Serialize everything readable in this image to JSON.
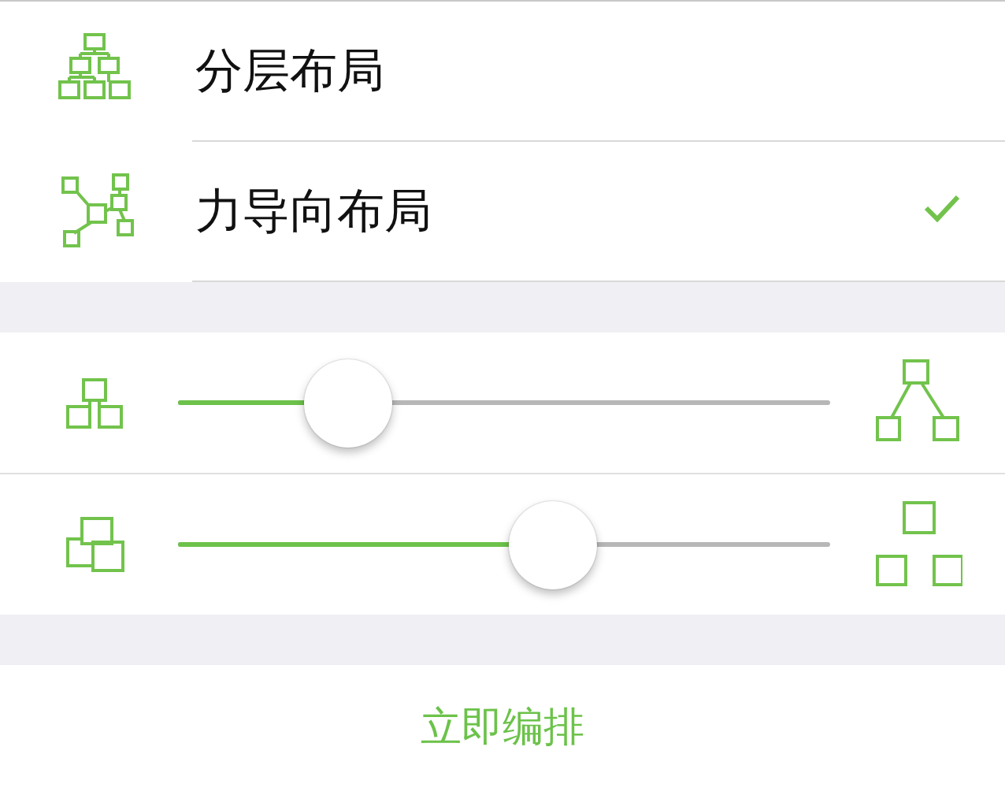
{
  "layouts": [
    {
      "label": "分层布局",
      "kind": "hierarchy",
      "selected": false
    },
    {
      "label": "力导向布局",
      "kind": "force",
      "selected": true
    }
  ],
  "sliders": [
    {
      "kind": "spacing",
      "level": 0.26
    },
    {
      "kind": "overlap",
      "level": 0.575
    }
  ],
  "action": {
    "label": "立即编排"
  }
}
